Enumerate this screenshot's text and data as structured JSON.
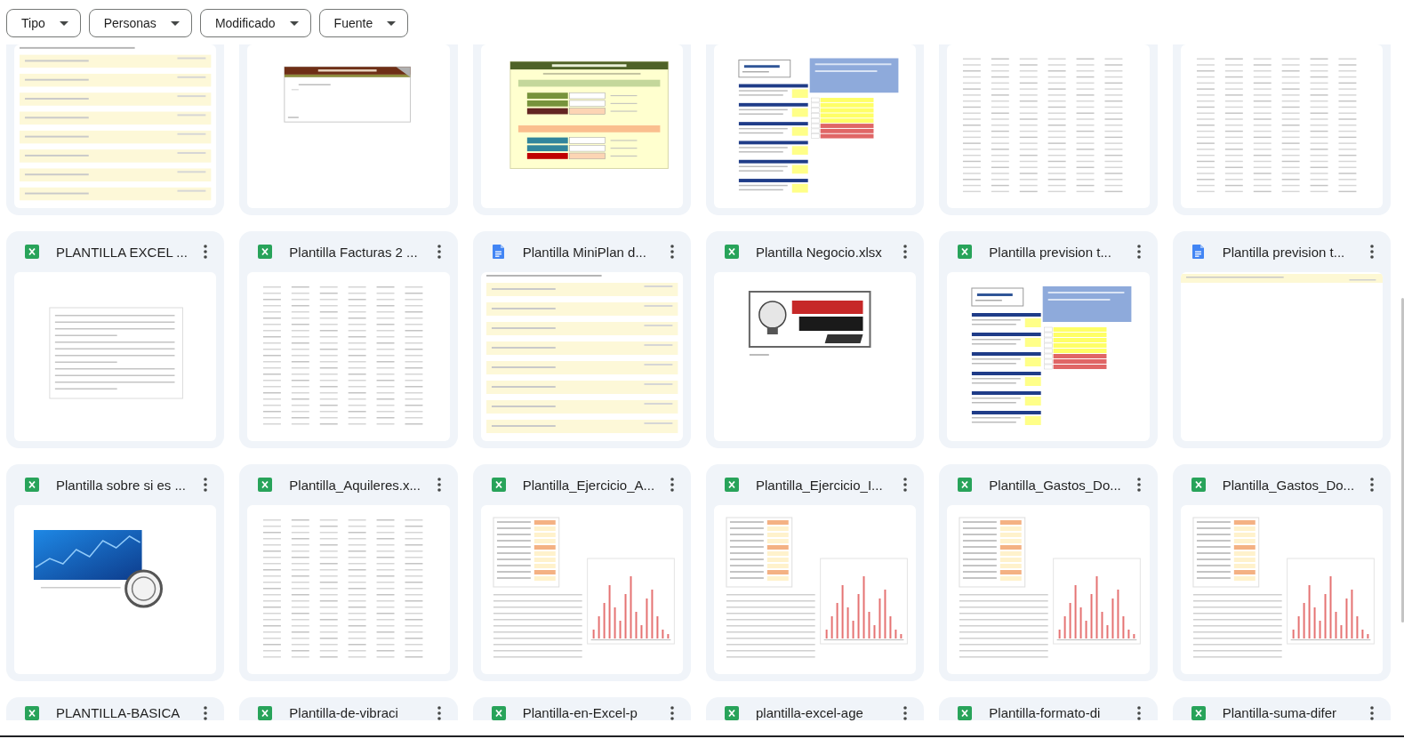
{
  "filters": [
    {
      "label": "Tipo"
    },
    {
      "label": "Personas"
    },
    {
      "label": "Modificado"
    },
    {
      "label": "Fuente"
    }
  ],
  "grid": {
    "top_row": [
      {
        "thumbnail": {
          "kind": "notes"
        }
      },
      {
        "thumbnail": {
          "kind": "banner"
        }
      },
      {
        "thumbnail": {
          "kind": "calculator"
        }
      },
      {
        "thumbnail": {
          "kind": "colored"
        }
      },
      {
        "thumbnail": {
          "kind": "table"
        }
      },
      {
        "thumbnail": {
          "kind": "table"
        }
      }
    ],
    "files": [
      {
        "title": "PLANTILLA EXCEL ...",
        "kind": "sheet",
        "thumbnail": {
          "kind": "text"
        }
      },
      {
        "title": "Plantilla Facturas 2 ...",
        "kind": "sheet",
        "thumbnail": {
          "kind": "table"
        }
      },
      {
        "title": "Plantilla MiniPlan d...",
        "kind": "doc",
        "thumbnail": {
          "kind": "notes"
        }
      },
      {
        "title": "Plantilla Negocio.xlsx",
        "kind": "sheet",
        "thumbnail": {
          "kind": "logo"
        }
      },
      {
        "title": "Plantilla prevision t...",
        "kind": "sheet",
        "thumbnail": {
          "kind": "colored"
        }
      },
      {
        "title": "Plantilla prevision t...",
        "kind": "doc",
        "thumbnail": {
          "kind": "blank"
        }
      },
      {
        "title": "Plantilla sobre si es ...",
        "kind": "sheet",
        "thumbnail": {
          "kind": "image"
        }
      },
      {
        "title": "Plantilla_Aquileres.x...",
        "kind": "sheet",
        "thumbnail": {
          "kind": "table"
        }
      },
      {
        "title": "Plantilla_Ejercicio_A...",
        "kind": "sheet",
        "thumbnail": {
          "kind": "chart"
        }
      },
      {
        "title": "Plantilla_Ejercicio_I...",
        "kind": "sheet",
        "thumbnail": {
          "kind": "chart"
        }
      },
      {
        "title": "Plantilla_Gastos_Do...",
        "kind": "sheet",
        "thumbnail": {
          "kind": "chart"
        }
      },
      {
        "title": "Plantilla_Gastos_Do...",
        "kind": "sheet",
        "thumbnail": {
          "kind": "chart"
        }
      }
    ],
    "bottom_row": [
      {
        "title": "PLANTILLA-BASICA",
        "kind": "sheet"
      },
      {
        "title": "Plantilla-de-vibraci",
        "kind": "sheet"
      },
      {
        "title": "Plantilla-en-Excel-p",
        "kind": "sheet"
      },
      {
        "title": "plantilla-excel-age",
        "kind": "sheet"
      },
      {
        "title": "Plantilla-formato-di",
        "kind": "sheet"
      },
      {
        "title": "Plantilla-suma-difer",
        "kind": "sheet"
      }
    ]
  }
}
